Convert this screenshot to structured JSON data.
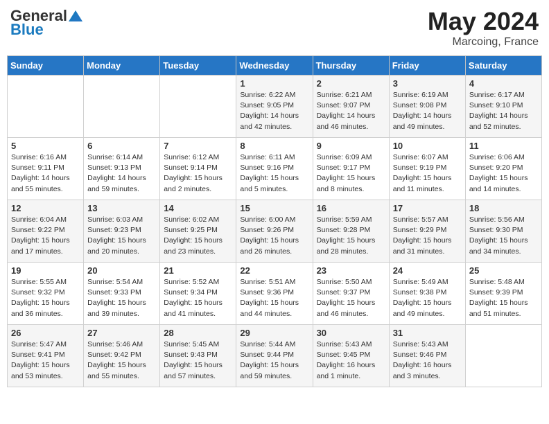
{
  "header": {
    "logo_general": "General",
    "logo_blue": "Blue",
    "month_year": "May 2024",
    "location": "Marcoing, France"
  },
  "days_of_week": [
    "Sunday",
    "Monday",
    "Tuesday",
    "Wednesday",
    "Thursday",
    "Friday",
    "Saturday"
  ],
  "weeks": [
    [
      {
        "day": "",
        "info": ""
      },
      {
        "day": "",
        "info": ""
      },
      {
        "day": "",
        "info": ""
      },
      {
        "day": "1",
        "info": "Sunrise: 6:22 AM\nSunset: 9:05 PM\nDaylight: 14 hours\nand 42 minutes."
      },
      {
        "day": "2",
        "info": "Sunrise: 6:21 AM\nSunset: 9:07 PM\nDaylight: 14 hours\nand 46 minutes."
      },
      {
        "day": "3",
        "info": "Sunrise: 6:19 AM\nSunset: 9:08 PM\nDaylight: 14 hours\nand 49 minutes."
      },
      {
        "day": "4",
        "info": "Sunrise: 6:17 AM\nSunset: 9:10 PM\nDaylight: 14 hours\nand 52 minutes."
      }
    ],
    [
      {
        "day": "5",
        "info": "Sunrise: 6:16 AM\nSunset: 9:11 PM\nDaylight: 14 hours\nand 55 minutes."
      },
      {
        "day": "6",
        "info": "Sunrise: 6:14 AM\nSunset: 9:13 PM\nDaylight: 14 hours\nand 59 minutes."
      },
      {
        "day": "7",
        "info": "Sunrise: 6:12 AM\nSunset: 9:14 PM\nDaylight: 15 hours\nand 2 minutes."
      },
      {
        "day": "8",
        "info": "Sunrise: 6:11 AM\nSunset: 9:16 PM\nDaylight: 15 hours\nand 5 minutes."
      },
      {
        "day": "9",
        "info": "Sunrise: 6:09 AM\nSunset: 9:17 PM\nDaylight: 15 hours\nand 8 minutes."
      },
      {
        "day": "10",
        "info": "Sunrise: 6:07 AM\nSunset: 9:19 PM\nDaylight: 15 hours\nand 11 minutes."
      },
      {
        "day": "11",
        "info": "Sunrise: 6:06 AM\nSunset: 9:20 PM\nDaylight: 15 hours\nand 14 minutes."
      }
    ],
    [
      {
        "day": "12",
        "info": "Sunrise: 6:04 AM\nSunset: 9:22 PM\nDaylight: 15 hours\nand 17 minutes."
      },
      {
        "day": "13",
        "info": "Sunrise: 6:03 AM\nSunset: 9:23 PM\nDaylight: 15 hours\nand 20 minutes."
      },
      {
        "day": "14",
        "info": "Sunrise: 6:02 AM\nSunset: 9:25 PM\nDaylight: 15 hours\nand 23 minutes."
      },
      {
        "day": "15",
        "info": "Sunrise: 6:00 AM\nSunset: 9:26 PM\nDaylight: 15 hours\nand 26 minutes."
      },
      {
        "day": "16",
        "info": "Sunrise: 5:59 AM\nSunset: 9:28 PM\nDaylight: 15 hours\nand 28 minutes."
      },
      {
        "day": "17",
        "info": "Sunrise: 5:57 AM\nSunset: 9:29 PM\nDaylight: 15 hours\nand 31 minutes."
      },
      {
        "day": "18",
        "info": "Sunrise: 5:56 AM\nSunset: 9:30 PM\nDaylight: 15 hours\nand 34 minutes."
      }
    ],
    [
      {
        "day": "19",
        "info": "Sunrise: 5:55 AM\nSunset: 9:32 PM\nDaylight: 15 hours\nand 36 minutes."
      },
      {
        "day": "20",
        "info": "Sunrise: 5:54 AM\nSunset: 9:33 PM\nDaylight: 15 hours\nand 39 minutes."
      },
      {
        "day": "21",
        "info": "Sunrise: 5:52 AM\nSunset: 9:34 PM\nDaylight: 15 hours\nand 41 minutes."
      },
      {
        "day": "22",
        "info": "Sunrise: 5:51 AM\nSunset: 9:36 PM\nDaylight: 15 hours\nand 44 minutes."
      },
      {
        "day": "23",
        "info": "Sunrise: 5:50 AM\nSunset: 9:37 PM\nDaylight: 15 hours\nand 46 minutes."
      },
      {
        "day": "24",
        "info": "Sunrise: 5:49 AM\nSunset: 9:38 PM\nDaylight: 15 hours\nand 49 minutes."
      },
      {
        "day": "25",
        "info": "Sunrise: 5:48 AM\nSunset: 9:39 PM\nDaylight: 15 hours\nand 51 minutes."
      }
    ],
    [
      {
        "day": "26",
        "info": "Sunrise: 5:47 AM\nSunset: 9:41 PM\nDaylight: 15 hours\nand 53 minutes."
      },
      {
        "day": "27",
        "info": "Sunrise: 5:46 AM\nSunset: 9:42 PM\nDaylight: 15 hours\nand 55 minutes."
      },
      {
        "day": "28",
        "info": "Sunrise: 5:45 AM\nSunset: 9:43 PM\nDaylight: 15 hours\nand 57 minutes."
      },
      {
        "day": "29",
        "info": "Sunrise: 5:44 AM\nSunset: 9:44 PM\nDaylight: 15 hours\nand 59 minutes."
      },
      {
        "day": "30",
        "info": "Sunrise: 5:43 AM\nSunset: 9:45 PM\nDaylight: 16 hours\nand 1 minute."
      },
      {
        "day": "31",
        "info": "Sunrise: 5:43 AM\nSunset: 9:46 PM\nDaylight: 16 hours\nand 3 minutes."
      },
      {
        "day": "",
        "info": ""
      }
    ]
  ]
}
